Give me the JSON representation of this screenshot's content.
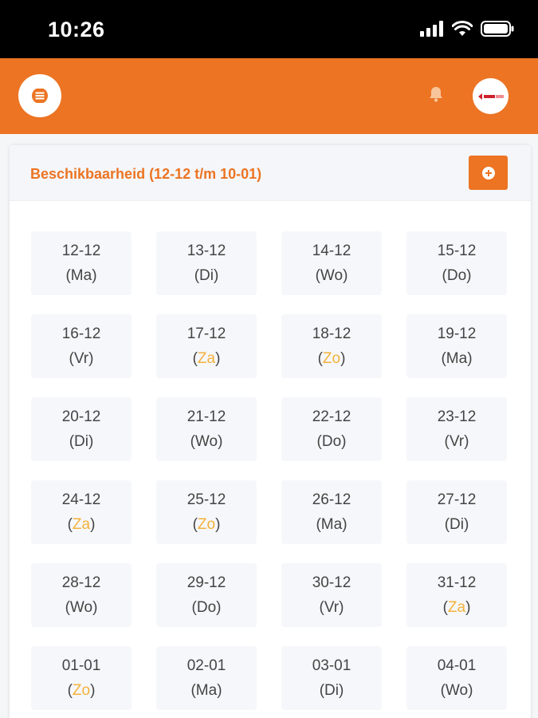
{
  "status": {
    "time": "10:26"
  },
  "header": {
    "menu_icon": "hamburger-menu-icon",
    "bell_icon": "bell-icon",
    "avatar_icon": "company-logo-avatar"
  },
  "availability": {
    "title": "Beschikbaarheid (12-12 t/m 10-01)",
    "add_icon": "plus-circle-icon",
    "days": [
      {
        "date": "12-12",
        "day": "Ma",
        "weekend": false
      },
      {
        "date": "13-12",
        "day": "Di",
        "weekend": false
      },
      {
        "date": "14-12",
        "day": "Wo",
        "weekend": false
      },
      {
        "date": "15-12",
        "day": "Do",
        "weekend": false
      },
      {
        "date": "16-12",
        "day": "Vr",
        "weekend": false
      },
      {
        "date": "17-12",
        "day": "Za",
        "weekend": true
      },
      {
        "date": "18-12",
        "day": "Zo",
        "weekend": true
      },
      {
        "date": "19-12",
        "day": "Ma",
        "weekend": false
      },
      {
        "date": "20-12",
        "day": "Di",
        "weekend": false
      },
      {
        "date": "21-12",
        "day": "Wo",
        "weekend": false
      },
      {
        "date": "22-12",
        "day": "Do",
        "weekend": false
      },
      {
        "date": "23-12",
        "day": "Vr",
        "weekend": false
      },
      {
        "date": "24-12",
        "day": "Za",
        "weekend": true
      },
      {
        "date": "25-12",
        "day": "Zo",
        "weekend": true
      },
      {
        "date": "26-12",
        "day": "Ma",
        "weekend": false
      },
      {
        "date": "27-12",
        "day": "Di",
        "weekend": false
      },
      {
        "date": "28-12",
        "day": "Wo",
        "weekend": false
      },
      {
        "date": "29-12",
        "day": "Do",
        "weekend": false
      },
      {
        "date": "30-12",
        "day": "Vr",
        "weekend": false
      },
      {
        "date": "31-12",
        "day": "Za",
        "weekend": true
      },
      {
        "date": "01-01",
        "day": "Zo",
        "weekend": true
      },
      {
        "date": "02-01",
        "day": "Ma",
        "weekend": false
      },
      {
        "date": "03-01",
        "day": "Di",
        "weekend": false
      },
      {
        "date": "04-01",
        "day": "Wo",
        "weekend": false
      }
    ]
  },
  "colors": {
    "accent": "#ec7423",
    "weekend": "#f3b23a",
    "text": "#444444",
    "cell_bg": "#f6f7fa"
  }
}
